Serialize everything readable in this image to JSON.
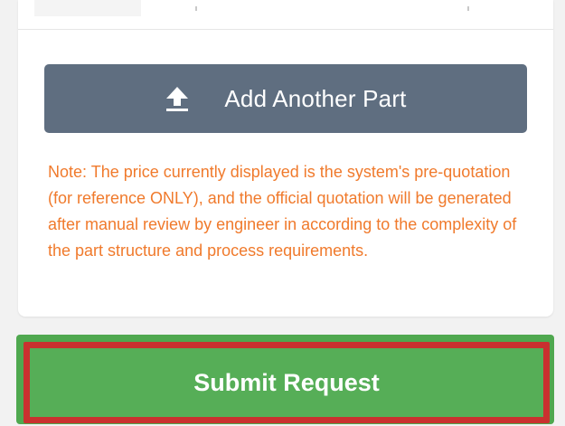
{
  "add_part": {
    "label": "Add Another Part",
    "icon": "upload-arrow-icon"
  },
  "note": {
    "text": "Note: The price currently displayed is the system's pre-quotation (for reference ONLY), and the official quotation will be generated after manual review by engineer in according to the complexity of the part structure and process requirements.",
    "color": "#f07a2c"
  },
  "submit": {
    "label": "Submit Request",
    "color": "#56ae57",
    "highlight_color": "#c9312f"
  },
  "colors": {
    "add_part_button": "#5f6e80",
    "page_background": "#f2f2f2"
  }
}
